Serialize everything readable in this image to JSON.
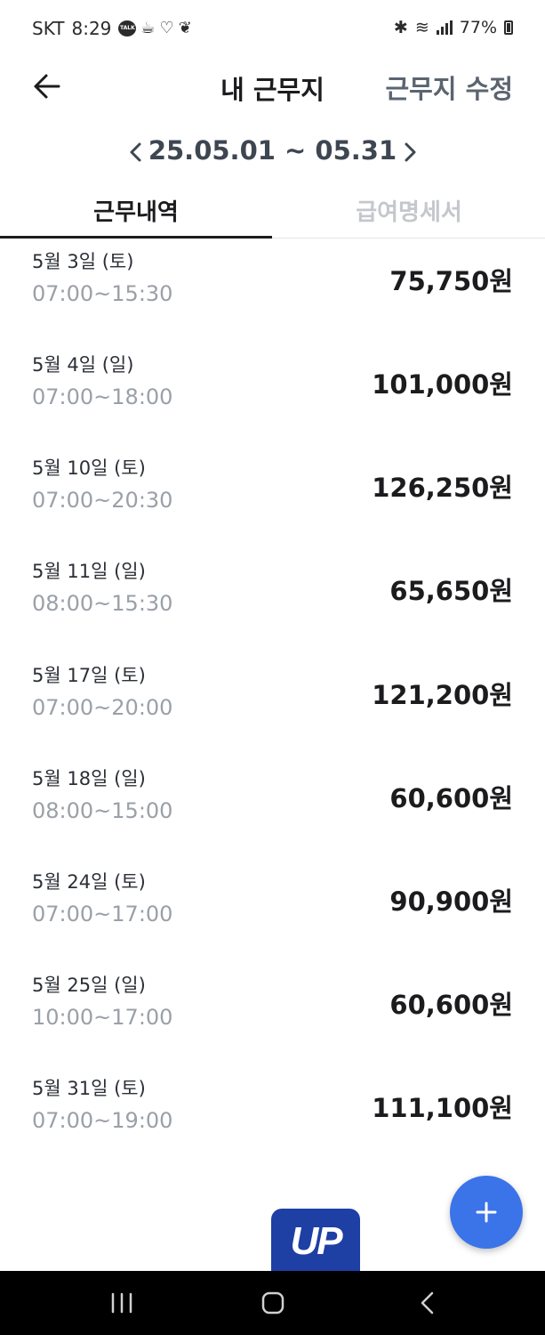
{
  "status_bar": {
    "carrier": "SKT",
    "time": "8:29",
    "talk_badge": "TALK",
    "battery": "77%"
  },
  "header": {
    "title": "내 근무지",
    "edit_label": "근무지 수정"
  },
  "period": {
    "label": "25.05.01 ~ 05.31"
  },
  "tabs": [
    {
      "label": "근무내역",
      "active": true
    },
    {
      "label": "급여명세서",
      "active": false
    }
  ],
  "work_records": [
    {
      "date": "5월 3일 (토)",
      "time": "07:00~15:30",
      "amount": "75,750원"
    },
    {
      "date": "5월 4일 (일)",
      "time": "07:00~18:00",
      "amount": "101,000원"
    },
    {
      "date": "5월 10일 (토)",
      "time": "07:00~20:30",
      "amount": "126,250원"
    },
    {
      "date": "5월 11일 (일)",
      "time": "08:00~15:30",
      "amount": "65,650원"
    },
    {
      "date": "5월 17일 (토)",
      "time": "07:00~20:00",
      "amount": "121,200원"
    },
    {
      "date": "5월 18일 (일)",
      "time": "08:00~15:00",
      "amount": "60,600원"
    },
    {
      "date": "5월 24일 (토)",
      "time": "07:00~17:00",
      "amount": "90,900원"
    },
    {
      "date": "5월 25일 (일)",
      "time": "10:00~17:00",
      "amount": "60,600원"
    },
    {
      "date": "5월 31일 (토)",
      "time": "07:00~19:00",
      "amount": "111,100원"
    }
  ],
  "logo": {
    "text": "UP"
  },
  "colors": {
    "accent": "#3b73e8",
    "logo": "#1e3fa4",
    "muted_text": "#9aa0a8",
    "edit_text": "#5b6470"
  },
  "icons": {
    "back": "arrow-left-icon",
    "prev": "chevron-left-icon",
    "next": "chevron-right-icon",
    "fab": "plus-icon"
  }
}
